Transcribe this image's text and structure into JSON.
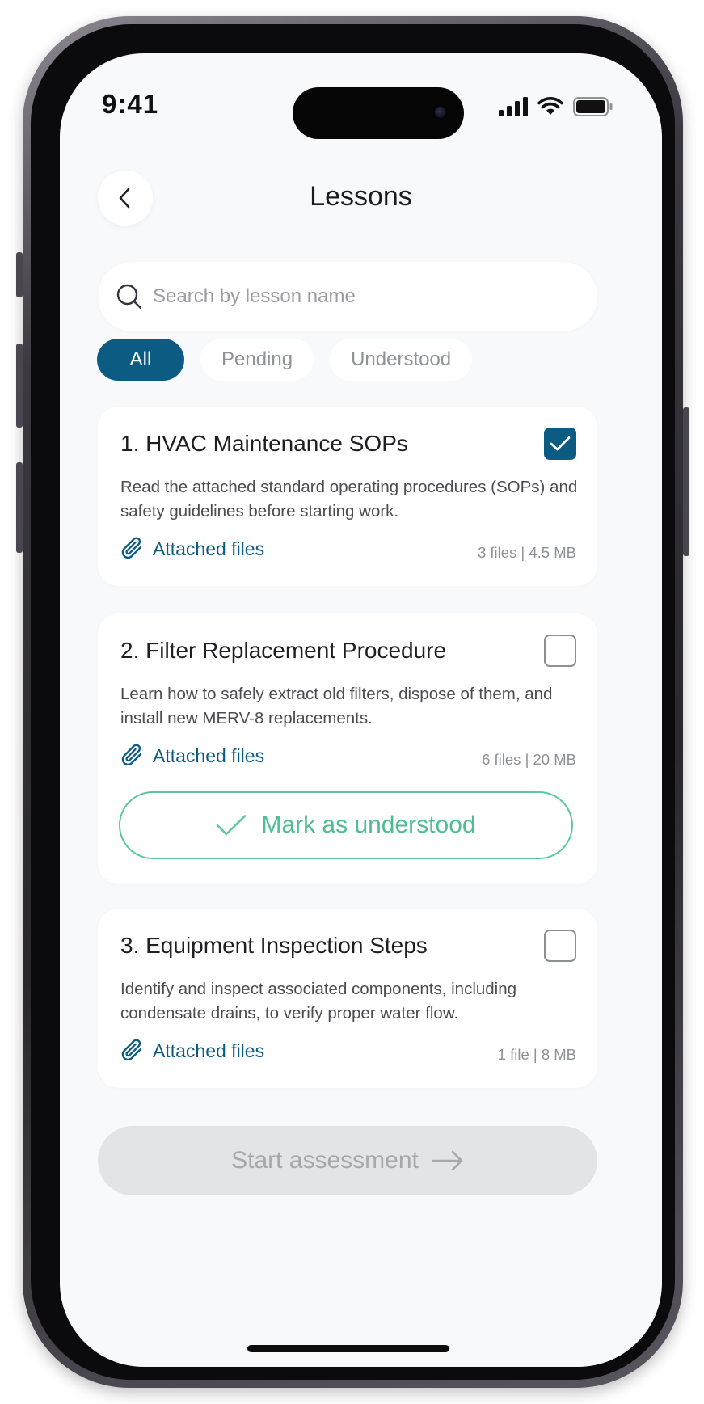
{
  "status_bar": {
    "time": "9:41",
    "icons": [
      "signal-icon",
      "wifi-icon",
      "battery-icon"
    ]
  },
  "header": {
    "title": "Lessons",
    "back_icon": "chevron-left-icon"
  },
  "search": {
    "placeholder": "Search by lesson name",
    "icon": "search-icon"
  },
  "filters": {
    "all": "All",
    "pending": "Pending",
    "understood": "Understood",
    "active": "All"
  },
  "lessons": [
    {
      "title": "1. HVAC Maintenance SOPs",
      "description": "Read the attached standard operating procedures (SOPs) and safety guidelines before starting work.",
      "files_label": "Attached files",
      "files_meta": "3 files | 4.5 MB",
      "checked": true
    },
    {
      "title": "2. Filter Replacement Procedure",
      "description": "Learn how to safely extract old filters, dispose of them, and install new MERV-8 replacements.",
      "files_label": "Attached files",
      "files_meta": "6 files | 20 MB",
      "checked": false,
      "action_label": "Mark as understood"
    },
    {
      "title": "3. Equipment Inspection Steps",
      "description": "Identify and inspect associated components, including condensate drains, to verify proper water flow.",
      "files_label": "Attached files",
      "files_meta": "1 file | 8 MB",
      "checked": false
    }
  ],
  "footer": {
    "start_label": "Start assessment"
  },
  "colors": {
    "primary": "#0c5b82",
    "success": "#4fbd8f",
    "disabled_bg": "#e3e4e6",
    "disabled_text": "#a6a8ad",
    "screen_bg": "#f7f9fa"
  }
}
